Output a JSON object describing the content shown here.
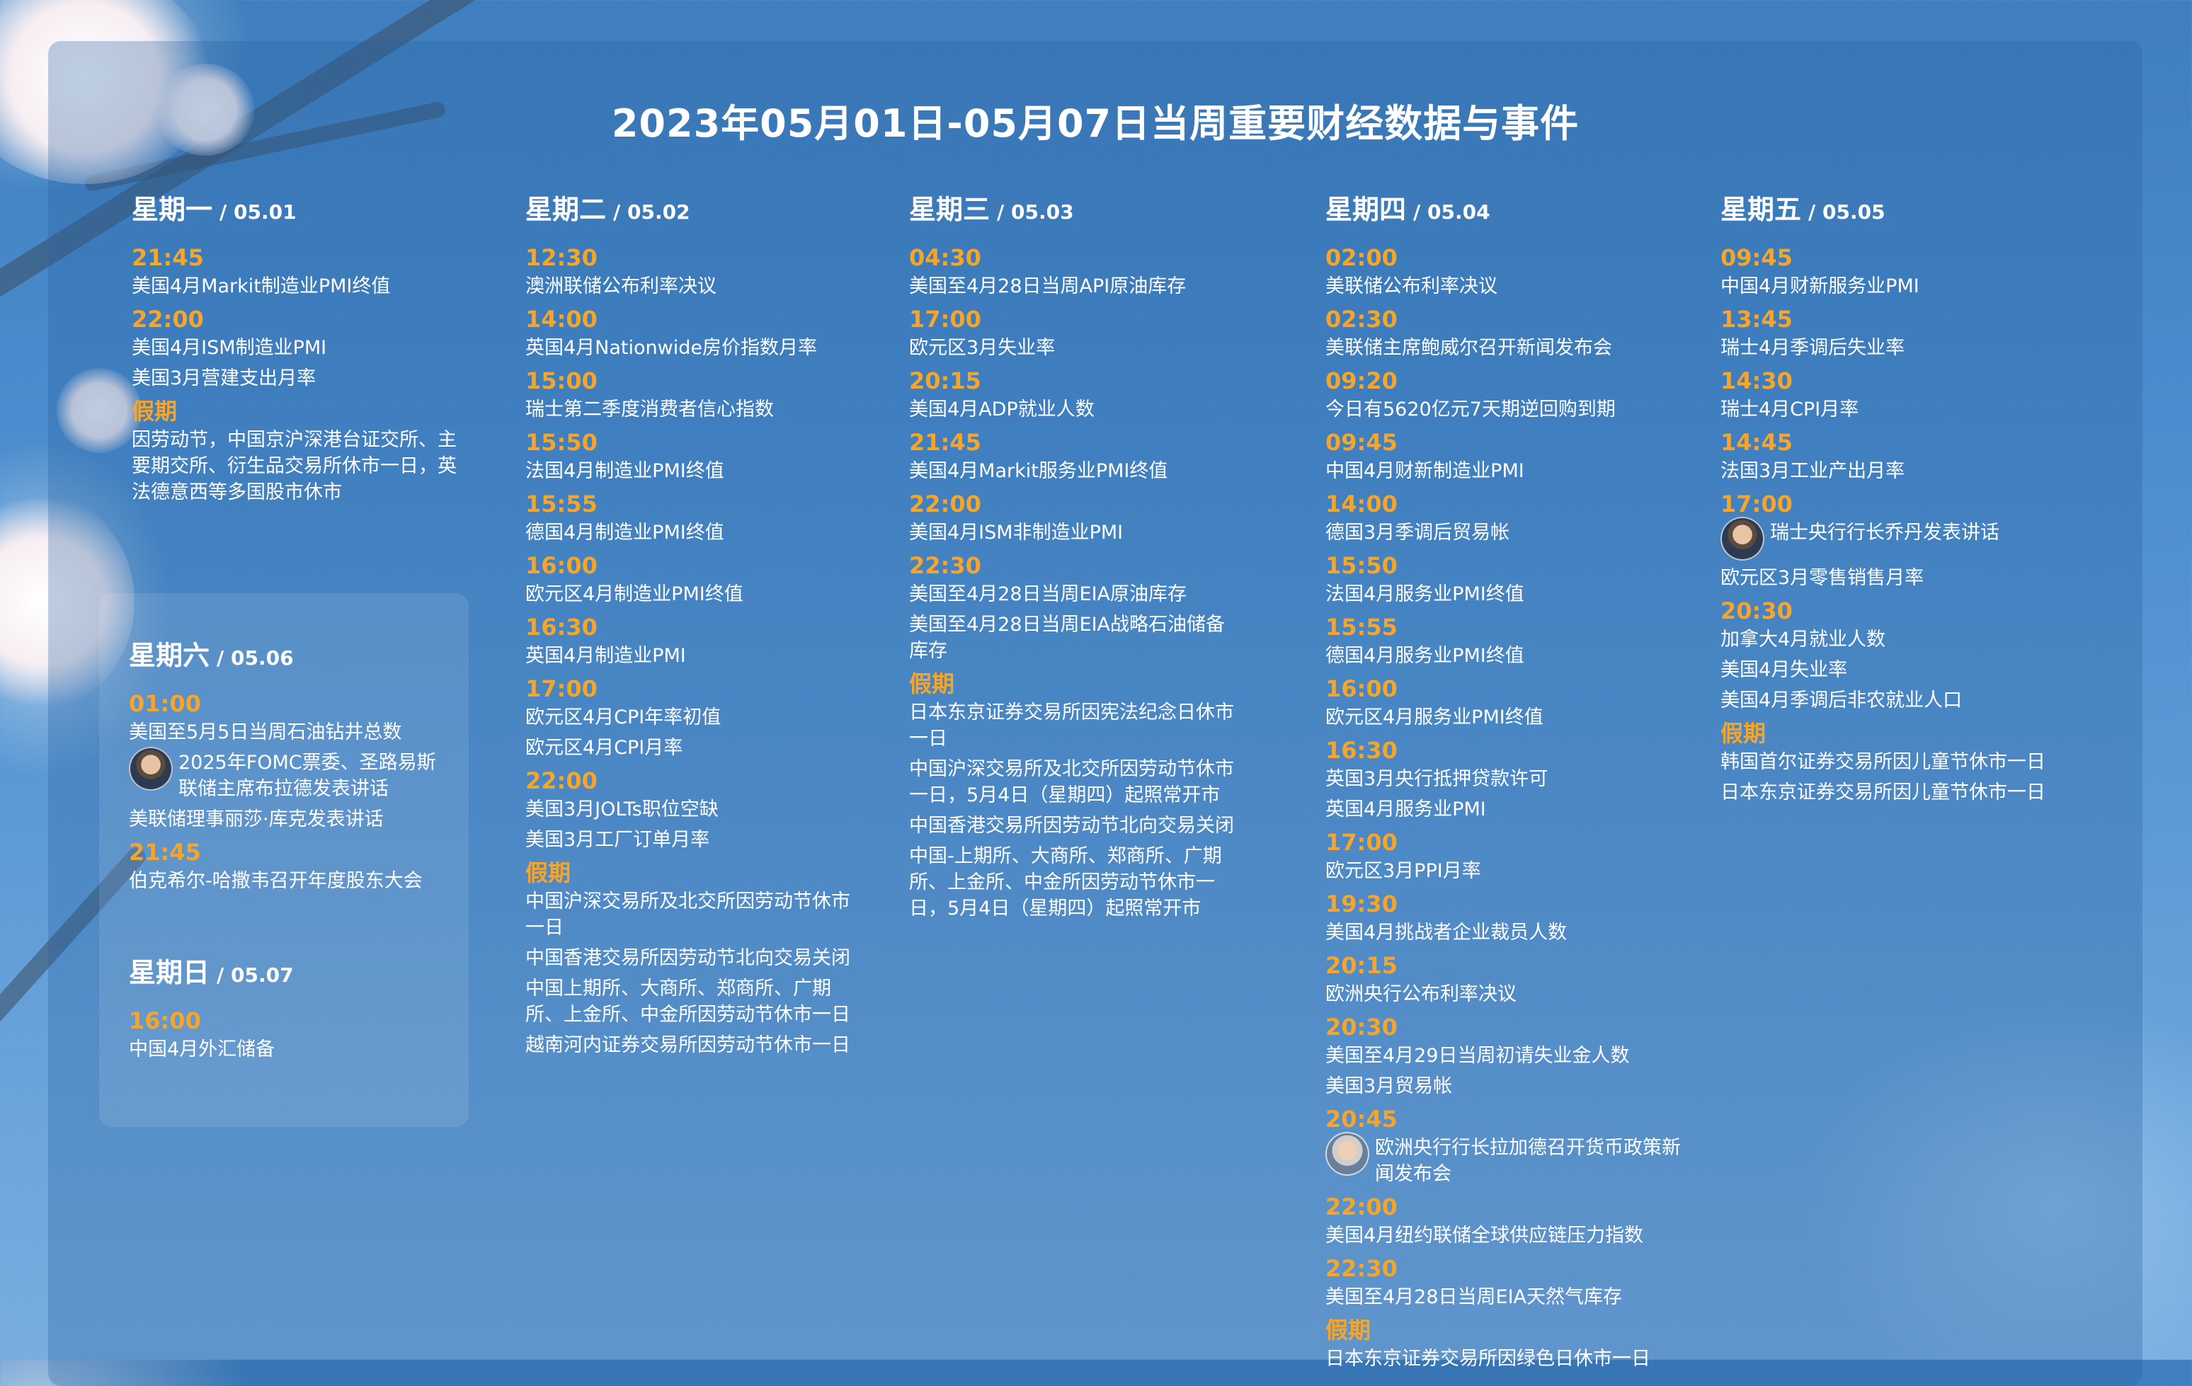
{
  "title": "2023年05月01日-05月07日当周重要财经数据与事件",
  "days": [
    {
      "name": "星期一",
      "date": "/ 05.01",
      "items": [
        {
          "type": "time",
          "text": "21:45"
        },
        {
          "type": "ev",
          "text": "美国4月Markit制造业PMI终值"
        },
        {
          "type": "time",
          "text": "22:00"
        },
        {
          "type": "ev",
          "text": "美国4月ISM制造业PMI"
        },
        {
          "type": "ev",
          "text": "美国3月营建支出月率"
        },
        {
          "type": "time",
          "text": "假期"
        },
        {
          "type": "ev",
          "text": "因劳动节，中国京沪深港台证交所、主要期交所、衍生品交易所休市一日，英法德意西等多国股市休市"
        }
      ]
    },
    {
      "name": "星期二",
      "date": "/ 05.02",
      "items": [
        {
          "type": "time",
          "text": "12:30"
        },
        {
          "type": "ev",
          "text": "澳洲联储公布利率决议"
        },
        {
          "type": "time",
          "text": "14:00"
        },
        {
          "type": "ev",
          "text": "英国4月Nationwide房价指数月率"
        },
        {
          "type": "time",
          "text": "15:00"
        },
        {
          "type": "ev",
          "text": "瑞士第二季度消费者信心指数"
        },
        {
          "type": "time",
          "text": "15:50"
        },
        {
          "type": "ev",
          "text": "法国4月制造业PMI终值"
        },
        {
          "type": "time",
          "text": "15:55"
        },
        {
          "type": "ev",
          "text": "德国4月制造业PMI终值"
        },
        {
          "type": "time",
          "text": "16:00"
        },
        {
          "type": "ev",
          "text": "欧元区4月制造业PMI终值"
        },
        {
          "type": "time",
          "text": "16:30"
        },
        {
          "type": "ev",
          "text": "英国4月制造业PMI"
        },
        {
          "type": "time",
          "text": "17:00"
        },
        {
          "type": "ev",
          "text": "欧元区4月CPI年率初值"
        },
        {
          "type": "ev",
          "text": "欧元区4月CPI月率"
        },
        {
          "type": "time",
          "text": "22:00"
        },
        {
          "type": "ev",
          "text": "美国3月JOLTs职位空缺"
        },
        {
          "type": "ev",
          "text": "美国3月工厂订单月率"
        },
        {
          "type": "time",
          "text": "假期"
        },
        {
          "type": "ev",
          "text": "中国沪深交易所及北交所因劳动节休市一日"
        },
        {
          "type": "ev",
          "text": "中国香港交易所因劳动节北向交易关闭"
        },
        {
          "type": "ev",
          "text": "中国上期所、大商所、郑商所、广期所、上金所、中金所因劳动节休市一日"
        },
        {
          "type": "ev",
          "text": "越南河内证券交易所因劳动节休市一日"
        }
      ]
    },
    {
      "name": "星期三",
      "date": "/ 05.03",
      "items": [
        {
          "type": "time",
          "text": "04:30"
        },
        {
          "type": "ev",
          "text": "美国至4月28日当周API原油库存"
        },
        {
          "type": "time",
          "text": "17:00"
        },
        {
          "type": "ev",
          "text": "欧元区3月失业率"
        },
        {
          "type": "time",
          "text": "20:15"
        },
        {
          "type": "ev",
          "text": "美国4月ADP就业人数"
        },
        {
          "type": "time",
          "text": "21:45"
        },
        {
          "type": "ev",
          "text": "美国4月Markit服务业PMI终值"
        },
        {
          "type": "time",
          "text": "22:00"
        },
        {
          "type": "ev",
          "text": "美国4月ISM非制造业PMI"
        },
        {
          "type": "time",
          "text": "22:30"
        },
        {
          "type": "ev",
          "text": "美国至4月28日当周EIA原油库存"
        },
        {
          "type": "ev",
          "text": "美国至4月28日当周EIA战略石油储备库存"
        },
        {
          "type": "time",
          "text": "假期"
        },
        {
          "type": "ev",
          "text": "日本东京证券交易所因宪法纪念日休市一日"
        },
        {
          "type": "ev",
          "text": "中国沪深交易所及北交所因劳动节休市一日，5月4日（星期四）起照常开市"
        },
        {
          "type": "ev",
          "text": "中国香港交易所因劳动节北向交易关闭"
        },
        {
          "type": "ev",
          "text": "中国-上期所、大商所、郑商所、广期所、上金所、中金所因劳动节休市一日，5月4日（星期四）起照常开市"
        }
      ]
    },
    {
      "name": "星期四",
      "date": "/ 05.04",
      "items": [
        {
          "type": "time",
          "text": "02:00"
        },
        {
          "type": "ev",
          "text": "美联储公布利率决议"
        },
        {
          "type": "time",
          "text": "02:30"
        },
        {
          "type": "ev",
          "text": "美联储主席鲍威尔召开新闻发布会"
        },
        {
          "type": "time",
          "text": "09:20"
        },
        {
          "type": "ev",
          "text": "今日有5620亿元7天期逆回购到期"
        },
        {
          "type": "time",
          "text": "09:45"
        },
        {
          "type": "ev",
          "text": "中国4月财新制造业PMI"
        },
        {
          "type": "time",
          "text": "14:00"
        },
        {
          "type": "ev",
          "text": "德国3月季调后贸易帐"
        },
        {
          "type": "time",
          "text": "15:50"
        },
        {
          "type": "ev",
          "text": "法国4月服务业PMI终值"
        },
        {
          "type": "time",
          "text": "15:55"
        },
        {
          "type": "ev",
          "text": "德国4月服务业PMI终值"
        },
        {
          "type": "time",
          "text": "16:00"
        },
        {
          "type": "ev",
          "text": "欧元区4月服务业PMI终值"
        },
        {
          "type": "time",
          "text": "16:30"
        },
        {
          "type": "ev",
          "text": "英国3月央行抵押贷款许可"
        },
        {
          "type": "ev",
          "text": "英国4月服务业PMI"
        },
        {
          "type": "time",
          "text": "17:00"
        },
        {
          "type": "ev",
          "text": "欧元区3月PPI月率"
        },
        {
          "type": "time",
          "text": "19:30"
        },
        {
          "type": "ev",
          "text": "美国4月挑战者企业裁员人数"
        },
        {
          "type": "time",
          "text": "20:15"
        },
        {
          "type": "ev",
          "text": "欧洲央行公布利率决议"
        },
        {
          "type": "time",
          "text": "20:30"
        },
        {
          "type": "ev",
          "text": "美国至4月29日当周初请失业金人数"
        },
        {
          "type": "ev",
          "text": "美国3月贸易帐"
        },
        {
          "type": "time",
          "text": "20:45"
        },
        {
          "type": "ev",
          "text": "欧洲央行行长拉加德召开货币政策新闻发布会",
          "avatar": "f"
        },
        {
          "type": "time",
          "text": "22:00"
        },
        {
          "type": "ev",
          "text": "美国4月纽约联储全球供应链压力指数"
        },
        {
          "type": "time",
          "text": "22:30"
        },
        {
          "type": "ev",
          "text": "美国至4月28日当周EIA天然气库存"
        },
        {
          "type": "time",
          "text": "假期"
        },
        {
          "type": "ev",
          "text": "日本东京证券交易所因绿色日休市一日"
        }
      ]
    },
    {
      "name": "星期五",
      "date": "/ 05.05",
      "items": [
        {
          "type": "time",
          "text": "09:45"
        },
        {
          "type": "ev",
          "text": "中国4月财新服务业PMI"
        },
        {
          "type": "time",
          "text": "13:45"
        },
        {
          "type": "ev",
          "text": "瑞士4月季调后失业率"
        },
        {
          "type": "time",
          "text": "14:30"
        },
        {
          "type": "ev",
          "text": "瑞士4月CPI月率"
        },
        {
          "type": "time",
          "text": "14:45"
        },
        {
          "type": "ev",
          "text": "法国3月工业产出月率"
        },
        {
          "type": "time",
          "text": "17:00"
        },
        {
          "type": "ev",
          "text": "瑞士央行行长乔丹发表讲话",
          "avatar": "m"
        },
        {
          "type": "ev",
          "text": "欧元区3月零售销售月率"
        },
        {
          "type": "time",
          "text": "20:30"
        },
        {
          "type": "ev",
          "text": "加拿大4月就业人数"
        },
        {
          "type": "ev",
          "text": "美国4月失业率"
        },
        {
          "type": "ev",
          "text": "美国4月季调后非农就业人口"
        },
        {
          "type": "time",
          "text": "假期"
        },
        {
          "type": "ev",
          "text": "韩国首尔证券交易所因儿童节休市一日"
        },
        {
          "type": "ev",
          "text": "日本东京证券交易所因儿童节休市一日"
        }
      ]
    },
    {
      "name": "星期六",
      "date": "/ 05.06",
      "items": [
        {
          "type": "time",
          "text": "01:00"
        },
        {
          "type": "ev",
          "text": "美国至5月5日当周石油钻井总数"
        },
        {
          "type": "ev",
          "text": "2025年FOMC票委、圣路易斯联储主席布拉德发表讲话",
          "avatar": "m"
        },
        {
          "type": "ev",
          "text": "美联储理事丽莎·库克发表讲话"
        },
        {
          "type": "time",
          "text": "21:45"
        },
        {
          "type": "ev",
          "text": "伯克希尔-哈撒韦召开年度股东大会"
        }
      ]
    },
    {
      "name": "星期日",
      "date": "/ 05.07",
      "items": [
        {
          "type": "time",
          "text": "16:00"
        },
        {
          "type": "ev",
          "text": "中国4月外汇储备"
        }
      ]
    }
  ],
  "colors": {
    "time": "#f5a52a",
    "text": "#ffffff",
    "panel": "rgba(40,95,160,0.30)"
  }
}
